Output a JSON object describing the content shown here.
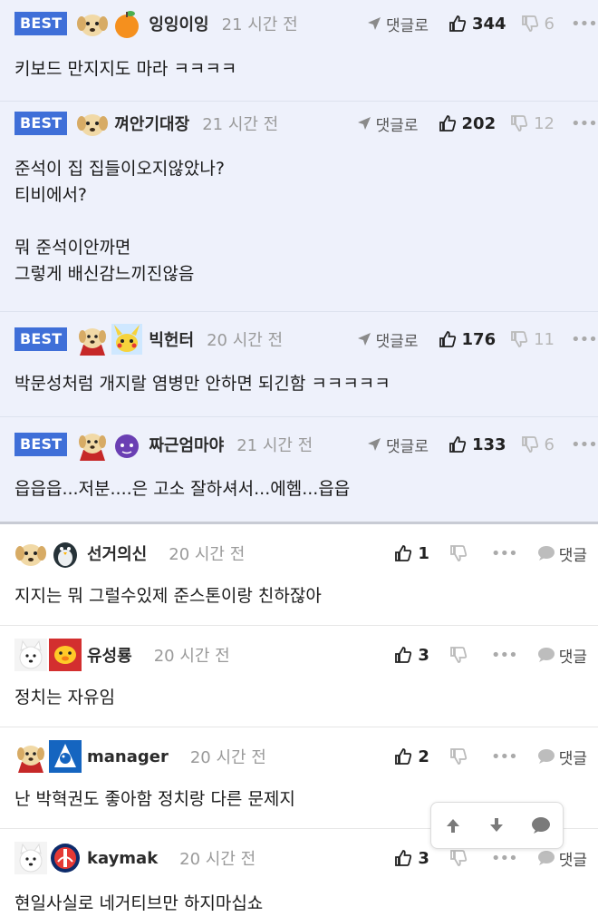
{
  "best_label": "BEST",
  "reply_label": "댓글로",
  "comment_label": "댓글",
  "more_label": "•••",
  "best_comments": [
    {
      "avatars": [
        "puppy-avatar",
        "orange-avatar"
      ],
      "nickname": "잉잉이잉",
      "time": "21 시간 전",
      "likes": "344",
      "dislikes": "6",
      "text": "키보드 만지지도 마라 ㅋㅋㅋㅋ"
    },
    {
      "avatars": [
        "puppy-avatar"
      ],
      "nickname": "껴안기대장",
      "time": "21 시간 전",
      "likes": "202",
      "dislikes": "12",
      "text": "준석이 집 집들이오지않았나?\n티비에서?\n\n뭐 준석이안까면\n그렇게 배신감느끼진않음"
    },
    {
      "avatars": [
        "puppy-red-avatar",
        "pikachu-avatar"
      ],
      "nickname": "빅헌터",
      "time": "20 시간 전",
      "likes": "176",
      "dislikes": "11",
      "text": "박문성처럼 개지랄 염병만 안하면 되긴함 ㅋㅋㅋㅋㅋ"
    },
    {
      "avatars": [
        "puppy-red-avatar",
        "purple-blob-avatar"
      ],
      "nickname": "짜근엄마야",
      "time": "21 시간 전",
      "likes": "133",
      "dislikes": "6",
      "text": "읍읍읍...저분....은 고소 잘하셔서...에헴...읍읍"
    }
  ],
  "comments": [
    {
      "avatars": [
        "puppy-avatar",
        "penguin-avatar"
      ],
      "nickname": "선거의신",
      "time": "20 시간 전",
      "likes": "1",
      "text": "지지는 뭐 그럴수있제 준스톤이랑 친하잖아"
    },
    {
      "avatars": [
        "white-dog-avatar",
        "red-pig-avatar"
      ],
      "nickname": "유성룡",
      "time": "20 시간 전",
      "likes": "3",
      "text": "정치는 자유임"
    },
    {
      "avatars": [
        "puppy-red-avatar",
        "blue-mascot-avatar"
      ],
      "nickname": "manager",
      "time": "20 시간 전",
      "likes": "2",
      "text": "난 박혁권도 좋아함 정치랑 다른 문제지"
    },
    {
      "avatars": [
        "white-dog-avatar",
        "psg-crest-avatar"
      ],
      "nickname": "kaymak",
      "time": "20 시간 전",
      "likes": "3",
      "text": "현일사실로 네거티브만 하지마십쇼"
    }
  ]
}
